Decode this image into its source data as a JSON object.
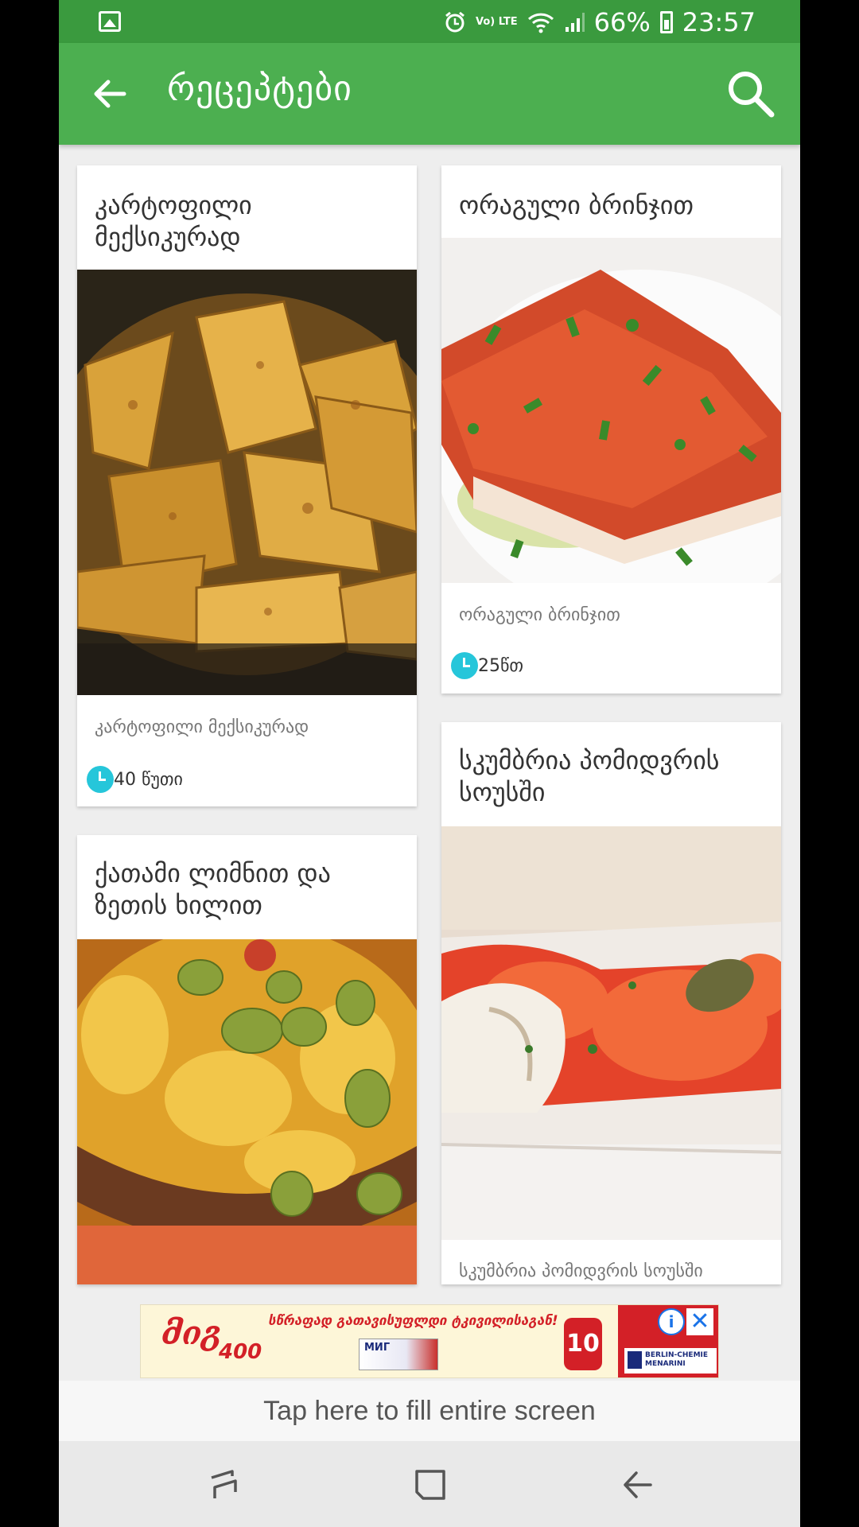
{
  "status": {
    "battery": "66%",
    "time": "23:57",
    "network": "Vo) LTE"
  },
  "app_bar": {
    "title": "რეცეპტები"
  },
  "recipes": [
    {
      "title": "კარტოფილი მექსიკურად",
      "subtitle": "კარტოფილი მექსიკურად",
      "time": "40 წუთი"
    },
    {
      "title": "ორაგული ბრინჯით",
      "subtitle": "ორაგული ბრინჯით",
      "time": "25წთ"
    },
    {
      "title": " ქათამი ლიმნით და ზეთის ხილით"
    },
    {
      "title": " სკუმბრია პომიდვრის სოუსში",
      "subtitle": "სკუმბრია პომიდვრის სოუსში"
    }
  ],
  "ad": {
    "brand": "მიგ",
    "dose": "400",
    "headline": "სწრაფად გათავისუფლდი ტკივილისაგან!",
    "pack_label": "МИГ",
    "badge": "10",
    "company": "BERLIN-CHEMIE MENARINI",
    "info_icon": "info-icon",
    "close_icon": "close-icon"
  },
  "fill_screen_text": "Tap here to fill entire screen",
  "colors": {
    "primary": "#4caf50",
    "status_bar": "#3a9a3e",
    "clock": "#26c6da",
    "ad_red": "#d32027"
  }
}
